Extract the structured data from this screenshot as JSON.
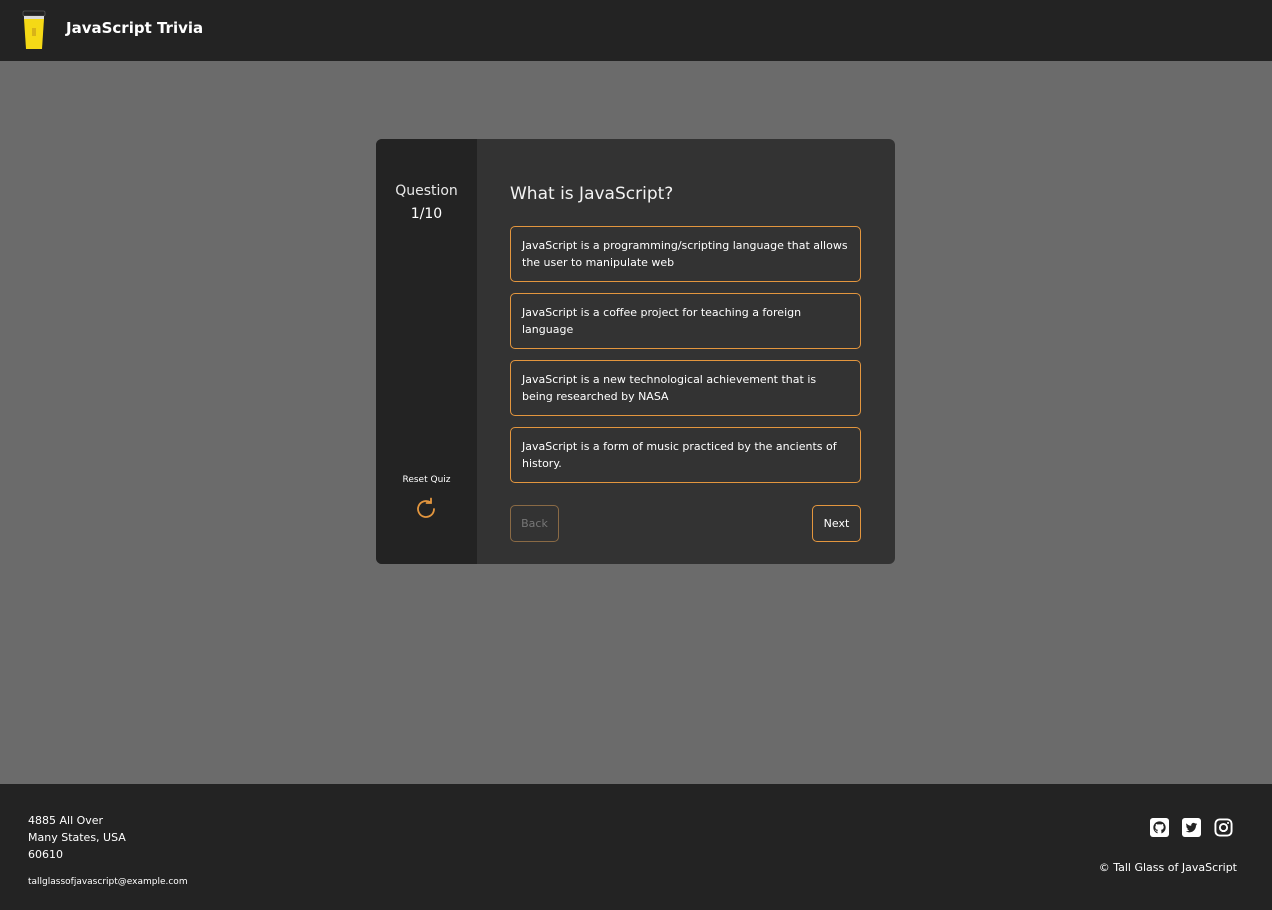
{
  "header": {
    "brand": "JavaScript Trivia",
    "logo_icon": "coffee-cup-icon"
  },
  "sidebar": {
    "question_label": "Question",
    "question_count": "1/10",
    "reset_label": "Reset Quiz",
    "reset_icon": "refresh-icon"
  },
  "quiz": {
    "question": "What is JavaScript?",
    "answers": [
      "JavaScript is a programming/scripting language that allows the user to manipulate web",
      "JavaScript is a coffee project for teaching a foreign language",
      "JavaScript is a new technological achievement that is being researched by NASA",
      "JavaScript is a form of music practiced by the ancients of history."
    ],
    "back_label": "Back",
    "next_label": "Next"
  },
  "footer": {
    "address_line1": "4885 All Over",
    "address_line2": "Many States, USA",
    "address_line3": "60610",
    "email": "tallglassofjavascript@example.com",
    "copyright": "© Tall Glass of JavaScript",
    "social_icons": [
      "github-icon",
      "twitter-icon",
      "instagram-icon"
    ]
  },
  "colors": {
    "accent": "#e3963e",
    "dark": "#232323",
    "card": "#333333",
    "background": "#6b6b6b",
    "logo_yellow": "#f5d916"
  }
}
